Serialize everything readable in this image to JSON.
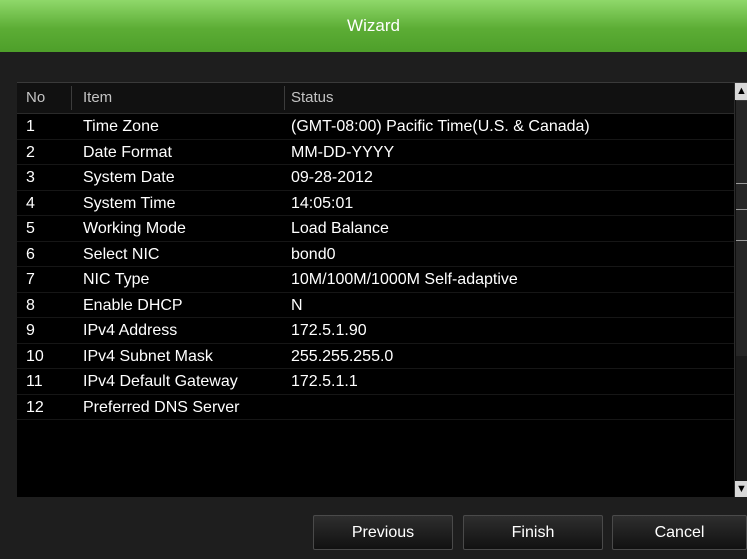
{
  "window": {
    "title": "Wizard"
  },
  "table": {
    "columns": [
      "No",
      "Item",
      "Status"
    ],
    "rows": [
      {
        "no": "1",
        "item": "Time Zone",
        "status": "(GMT-08:00) Pacific Time(U.S. & Canada)"
      },
      {
        "no": "2",
        "item": "Date Format",
        "status": "MM-DD-YYYY"
      },
      {
        "no": "3",
        "item": "System Date",
        "status": "09-28-2012"
      },
      {
        "no": "4",
        "item": "System Time",
        "status": "14:05:01"
      },
      {
        "no": "5",
        "item": "Working Mode",
        "status": "Load Balance"
      },
      {
        "no": "6",
        "item": "Select NIC",
        "status": "bond0"
      },
      {
        "no": "7",
        "item": "NIC Type",
        "status": "10M/100M/1000M Self-adaptive"
      },
      {
        "no": "8",
        "item": "Enable DHCP",
        "status": "N"
      },
      {
        "no": "9",
        "item": "IPv4 Address",
        "status": "172.5.1.90"
      },
      {
        "no": "10",
        "item": "IPv4 Subnet Mask",
        "status": "255.255.255.0"
      },
      {
        "no": "11",
        "item": "IPv4 Default Gateway",
        "status": "172.5.1.1"
      },
      {
        "no": "12",
        "item": "Preferred DNS Server",
        "status": ""
      }
    ]
  },
  "buttons": {
    "previous": "Previous",
    "finish": "Finish",
    "cancel": "Cancel"
  },
  "icons": {
    "scroll_up": "chevron-up-icon",
    "scroll_down": "chevron-down-icon"
  },
  "colors": {
    "title_bar": "#5cad35",
    "background": "#1e1e1e",
    "table_bg": "#000000"
  }
}
